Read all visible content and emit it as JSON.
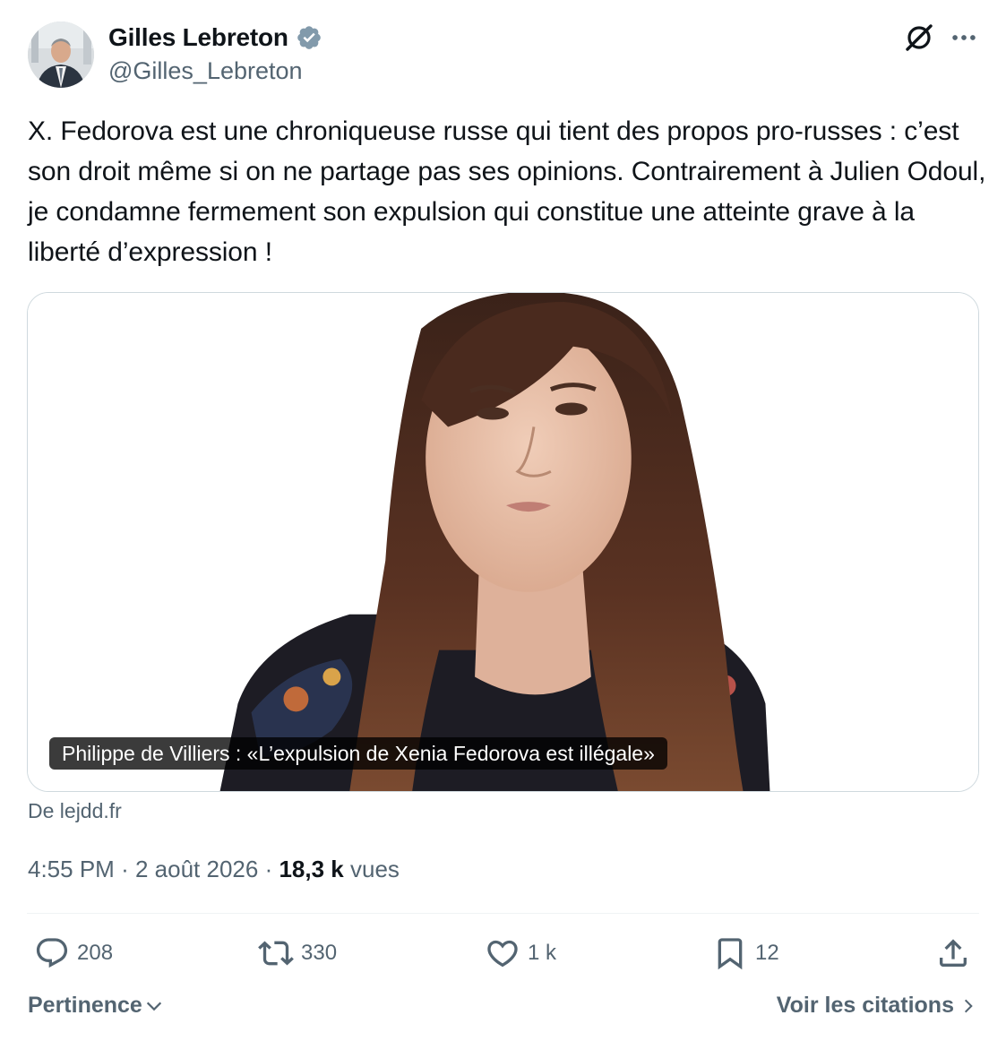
{
  "author": {
    "name": "Gilles Lebreton",
    "handle": "@Gilles_Lebreton",
    "verified": true
  },
  "tweet": {
    "text": "X. Fedorova est une chroniqueuse russe qui tient des propos pro-russes : c’est son droit même si on ne partage pas ses opinions. Contrairement à Julien Odoul, je condamne fermement son expulsion qui constitue une atteinte grave à la liberté d’expression !"
  },
  "card": {
    "caption": "Philippe de Villiers : «L’expulsion de Xenia Fedorova est illégale»",
    "source": "De lejdd.fr"
  },
  "meta": {
    "time": "4:55 PM",
    "separator": "·",
    "date": "2 août 2026",
    "views_count": "18,3 k",
    "views_label": "vues"
  },
  "actions": {
    "replies": "208",
    "retweets": "330",
    "likes": "1 k",
    "bookmarks": "12"
  },
  "footer": {
    "sort_label": "Pertinence",
    "quotes_label": "Voir les citations"
  },
  "colors": {
    "text": "#0f1419",
    "secondary": "#536471",
    "border": "#cfd9de",
    "verified": "#829aab"
  },
  "icons": {
    "verified": "verified-badge-icon",
    "grok": "grok-icon",
    "more": "more-horizontal-icon",
    "reply": "reply-icon",
    "retweet": "retweet-icon",
    "like": "heart-icon",
    "bookmark": "bookmark-icon",
    "share": "share-icon"
  }
}
